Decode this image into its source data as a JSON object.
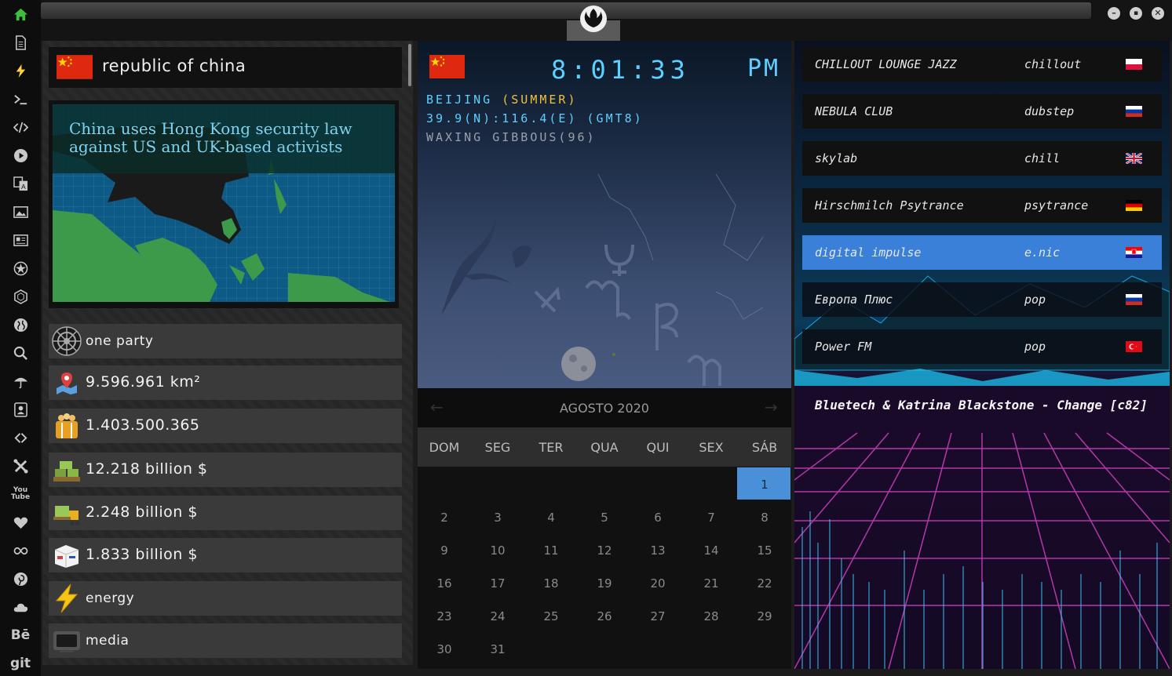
{
  "sidebar": {
    "icons": [
      "home-icon",
      "document-icon",
      "lightning-icon",
      "terminal-icon",
      "code-icon",
      "play-icon",
      "translate-icon",
      "image-icon",
      "newspaper-icon",
      "atom-icon",
      "hexagon-icon",
      "globe-icon",
      "search-icon",
      "umbrella-icon",
      "contact-icon",
      "link-icon",
      "tools-icon",
      "youtube-icon",
      "heart-icon",
      "infinity-icon",
      "pinterest-icon",
      "cloud-icon",
      "behance-icon",
      "git-icon"
    ],
    "youtube_text": "You Tube",
    "behance_text": "Bē",
    "git_text": "git",
    "accent": "#3fbf3f"
  },
  "window": {
    "minimize_glyph": "–",
    "maximize_glyph": "▪",
    "close_glyph": "✕",
    "logo": "rebel-alliance-icon"
  },
  "country": {
    "name": "republic of china",
    "news_headline": "China uses Hong Kong security law against US and UK-based activists",
    "stats": [
      {
        "icon": "imperial-emblem-icon",
        "text": "one party"
      },
      {
        "icon": "map-pin-icon",
        "text": "9.596.961 km²"
      },
      {
        "icon": "population-icon",
        "text": "1.403.500.365"
      },
      {
        "icon": "money-pallet-icon",
        "text": "12.218 billion $"
      },
      {
        "icon": "forklift-cargo-icon",
        "text": "2.248 billion $"
      },
      {
        "icon": "package-icon",
        "text": "1.833 billion $"
      },
      {
        "icon": "energy-icon",
        "text": "energy"
      },
      {
        "icon": "tv-media-icon",
        "text": "media"
      }
    ]
  },
  "clock": {
    "time": "8:01:33",
    "ampm": "PM",
    "location_prefix": "BEIJING ",
    "season": "(SUMMER)",
    "coords": "39.9(N):116.4(E) (GMT8)",
    "moon": "WAXING GIBBOUS(96)",
    "colors": {
      "time": "#5cd0ff",
      "season": "#f0c040"
    }
  },
  "calendar": {
    "month": "AGOSTO 2020",
    "prev": "←",
    "next": "→",
    "weekdays": [
      "DOM",
      "SEG",
      "TER",
      "QUA",
      "QUI",
      "SEX",
      "SÁB"
    ],
    "today": "1",
    "rows": [
      [
        "",
        "",
        "",
        "",
        "",
        "",
        "1"
      ],
      [
        "2",
        "3",
        "4",
        "5",
        "6",
        "7",
        "8"
      ],
      [
        "9",
        "10",
        "11",
        "12",
        "13",
        "14",
        "15"
      ],
      [
        "16",
        "17",
        "18",
        "19",
        "20",
        "21",
        "22"
      ],
      [
        "23",
        "24",
        "25",
        "26",
        "27",
        "28",
        "29"
      ],
      [
        "30",
        "31",
        "",
        "",
        "",
        "",
        ""
      ]
    ],
    "today_color": "#4a90d9"
  },
  "radio": {
    "stations": [
      {
        "name": "CHILLOUT LOUNGE JAZZ",
        "genre": "chillout",
        "flag": "poland-flag-icon",
        "active": false
      },
      {
        "name": "NEBULA CLUB",
        "genre": "dubstep",
        "flag": "russia-flag-icon",
        "active": false
      },
      {
        "name": "skylab",
        "genre": "chill",
        "flag": "uk-flag-icon",
        "active": false
      },
      {
        "name": "Hirschmilch Psytrance",
        "genre": "psytrance",
        "flag": "germany-flag-icon",
        "active": false
      },
      {
        "name": "digital impulse",
        "genre": "e.nic",
        "flag": "croatia-flag-icon",
        "active": true
      },
      {
        "name": "Европа Плюс",
        "genre": "pop",
        "flag": "russia-flag-icon",
        "active": false
      },
      {
        "name": "Power FM",
        "genre": "pop",
        "flag": "turkey-flag-icon",
        "active": false
      }
    ],
    "now_playing": "Bluetech & Katrina Blackstone - Change [c82]",
    "active_color": "#3a7fd8"
  }
}
